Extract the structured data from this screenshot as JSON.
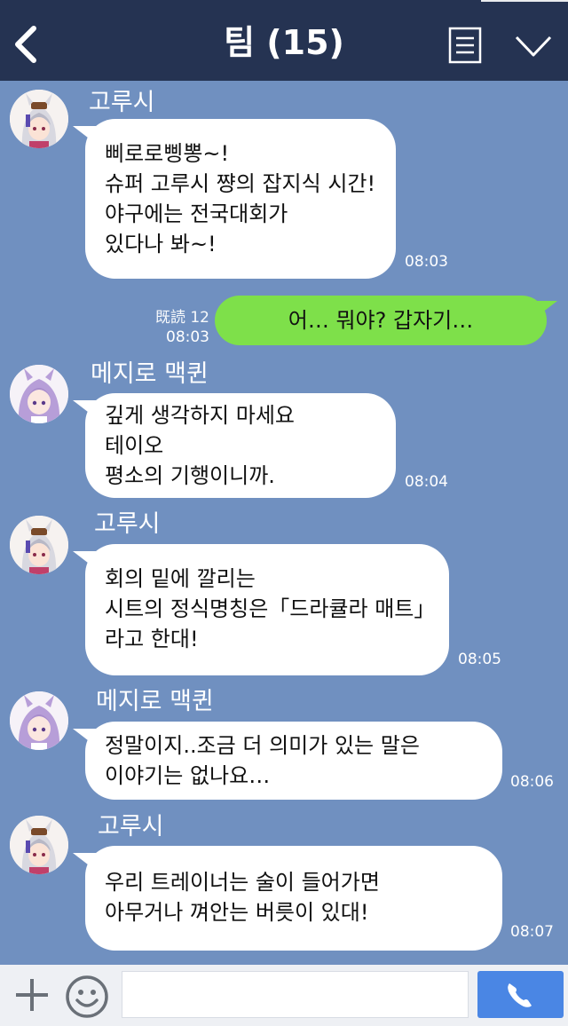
{
  "header": {
    "title": "팀 (15)",
    "back_icon": "chevron-left-icon",
    "menu_icon": "list-icon",
    "collapse_icon": "chevron-down-icon"
  },
  "messages": [
    {
      "sender": "고루시",
      "lines": [
        "삐로로삥뽕~!",
        "슈퍼 고루시 쨩의 잡지식 시간!",
        "야구에는 전국대회가",
        "있다나 봐~!"
      ],
      "time": "08:03"
    },
    {
      "mine": true,
      "text": "어… 뭐야? 갑자기…",
      "read_label": "既読 12",
      "time": "08:03"
    },
    {
      "sender": "메지로 맥퀸",
      "lines": [
        "깊게 생각하지 마세요",
        "테이오",
        "평소의 기행이니까."
      ],
      "time": "08:04"
    },
    {
      "sender": "고루시",
      "lines": [
        "회의 밑에 깔리는",
        "시트의 정식명칭은「드라큘라 매트」",
        "라고 한대!"
      ],
      "time": "08:05"
    },
    {
      "sender": "메지로 맥퀸",
      "lines": [
        "정말이지..조금 더 의미가 있는 말은",
        "이야기는 없나요…"
      ],
      "time": "08:06"
    },
    {
      "sender": "고루시",
      "lines": [
        "우리 트레이너는 술이 들어가면",
        "아무거나 껴안는 버릇이 있대!"
      ],
      "time": "08:07"
    }
  ],
  "input": {
    "value": "",
    "plus_icon": "plus-icon",
    "emoji_icon": "smiley-icon",
    "send_icon": "phone-icon"
  },
  "colors": {
    "header_bg": "#253352",
    "chat_bg": "#7090c0",
    "my_bubble": "#7ee04a",
    "their_bubble": "#ffffff",
    "send_button": "#4a86e4"
  }
}
